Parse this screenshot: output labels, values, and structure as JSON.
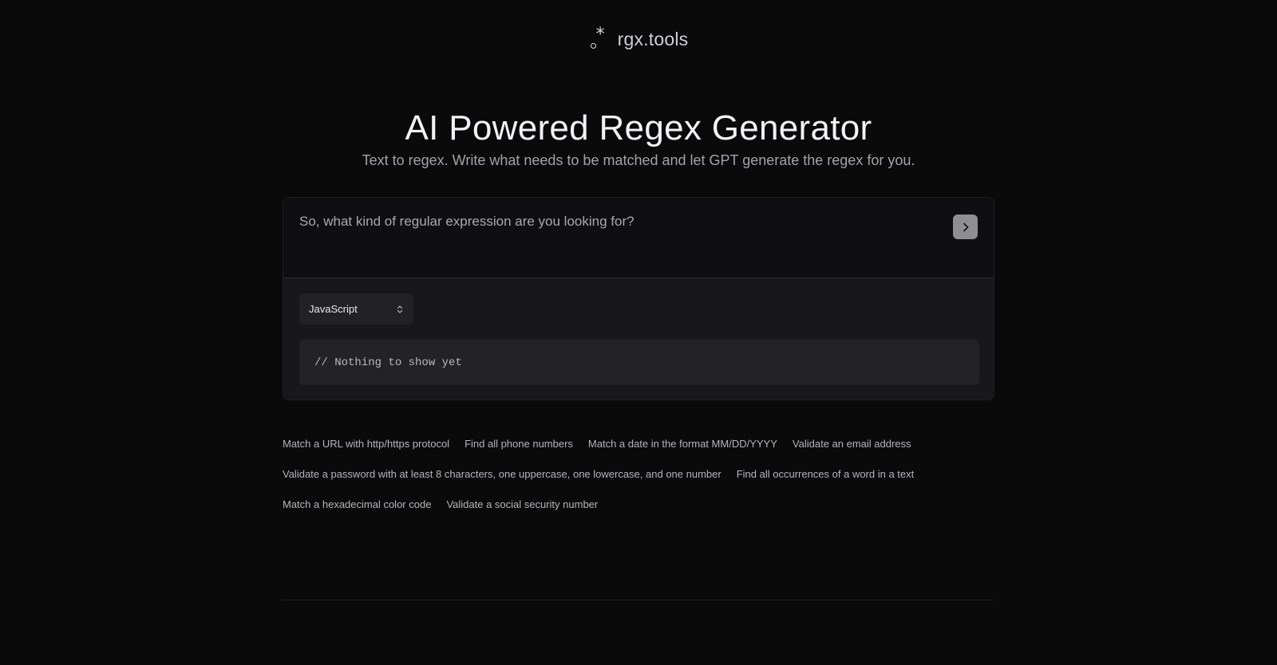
{
  "brand": {
    "icon": "regex-dot-star-icon",
    "name": "rgx.tools"
  },
  "hero": {
    "title": "AI Powered Regex Generator",
    "subtitle": "Text to regex. Write what needs to be matched and let GPT generate the regex for you."
  },
  "prompt": {
    "placeholder": "So, what kind of regular expression are you looking for?",
    "submit_icon": "chevron-right-icon"
  },
  "language": {
    "selected": "JavaScript",
    "icon": "chevron-up-down-icon"
  },
  "output": {
    "text": "// Nothing to show yet"
  },
  "examples": [
    "Match a URL with http/https protocol",
    "Find all phone numbers",
    "Match a date in the format MM/DD/YYYY",
    "Validate an email address",
    "Validate a password with at least 8 characters, one uppercase, one lowercase, and one number",
    "Find all occurrences of a word in a text",
    "Match a hexadecimal color code",
    "Validate a social security number"
  ],
  "colors": {
    "background": "#0a0a0b",
    "card": "#18181b",
    "submit_button": "#8e8e93"
  }
}
